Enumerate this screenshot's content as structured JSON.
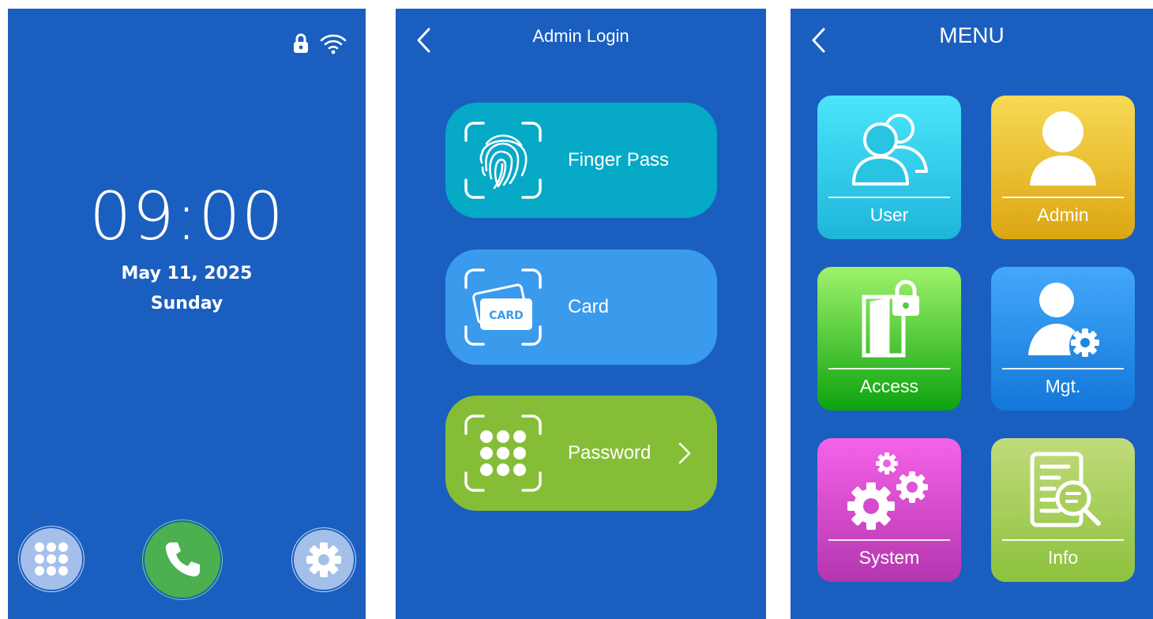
{
  "idle": {
    "time": "09:00",
    "date": "May 11, 2025",
    "day": "Sunday",
    "status_icons": [
      "lock-icon",
      "wifi-icon"
    ],
    "buttons": [
      "keypad-icon",
      "phone-icon",
      "gear-icon"
    ],
    "colors": {
      "background": "#1a5fbf",
      "call": "#4caf50",
      "secondary": "#a4c0ea"
    }
  },
  "login": {
    "title": "Admin Login",
    "options": [
      {
        "label": "Finger Pass",
        "icon": "fingerprint-icon",
        "color": "#06a9c6"
      },
      {
        "label": "Card",
        "icon": "card-icon",
        "card_text": "CARD",
        "color": "#3a9aec"
      },
      {
        "label": "Password",
        "icon": "keypad-icon",
        "color": "#86bd37"
      }
    ]
  },
  "menu": {
    "title": "MENU",
    "tiles": [
      {
        "label": "User",
        "icon": "users-icon"
      },
      {
        "label": "Admin",
        "icon": "admin-icon"
      },
      {
        "label": "Access",
        "icon": "door-lock-icon"
      },
      {
        "label": "Mgt.",
        "icon": "user-gear-icon"
      },
      {
        "label": "System",
        "icon": "gears-icon"
      },
      {
        "label": "Info",
        "icon": "document-search-icon"
      }
    ]
  }
}
